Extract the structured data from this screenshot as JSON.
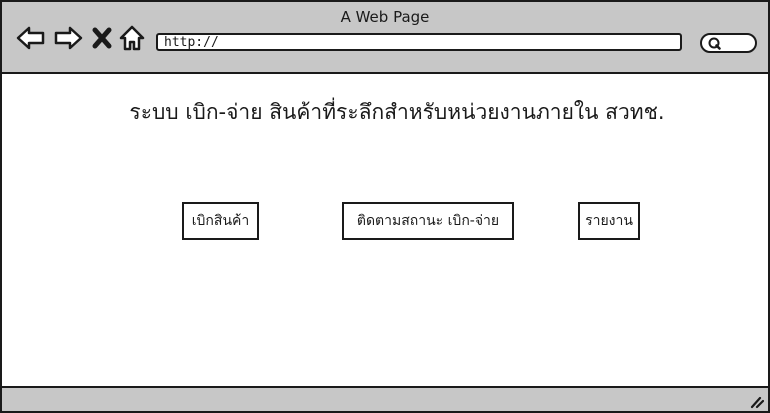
{
  "browser": {
    "title": "A Web Page",
    "address": "http://",
    "icons": {
      "back": "back-arrow-icon",
      "forward": "forward-arrow-icon",
      "stop": "close-icon",
      "home": "home-icon",
      "search": "search-icon",
      "resize": "resize-grip-icon"
    }
  },
  "page": {
    "heading": "ระบบ เบิก-จ่าย สินค้าที่ระลึกสำหรับหน่วยงานภายใน สวทช.",
    "buttons": {
      "withdraw": "เบิกสินค้า",
      "track": "ติดตามสถานะ เบิก-จ่าย",
      "report": "รายงาน"
    }
  },
  "colors": {
    "chrome": "#c7c7c7",
    "ink": "#1a1a1a",
    "background": "#ffffff"
  }
}
